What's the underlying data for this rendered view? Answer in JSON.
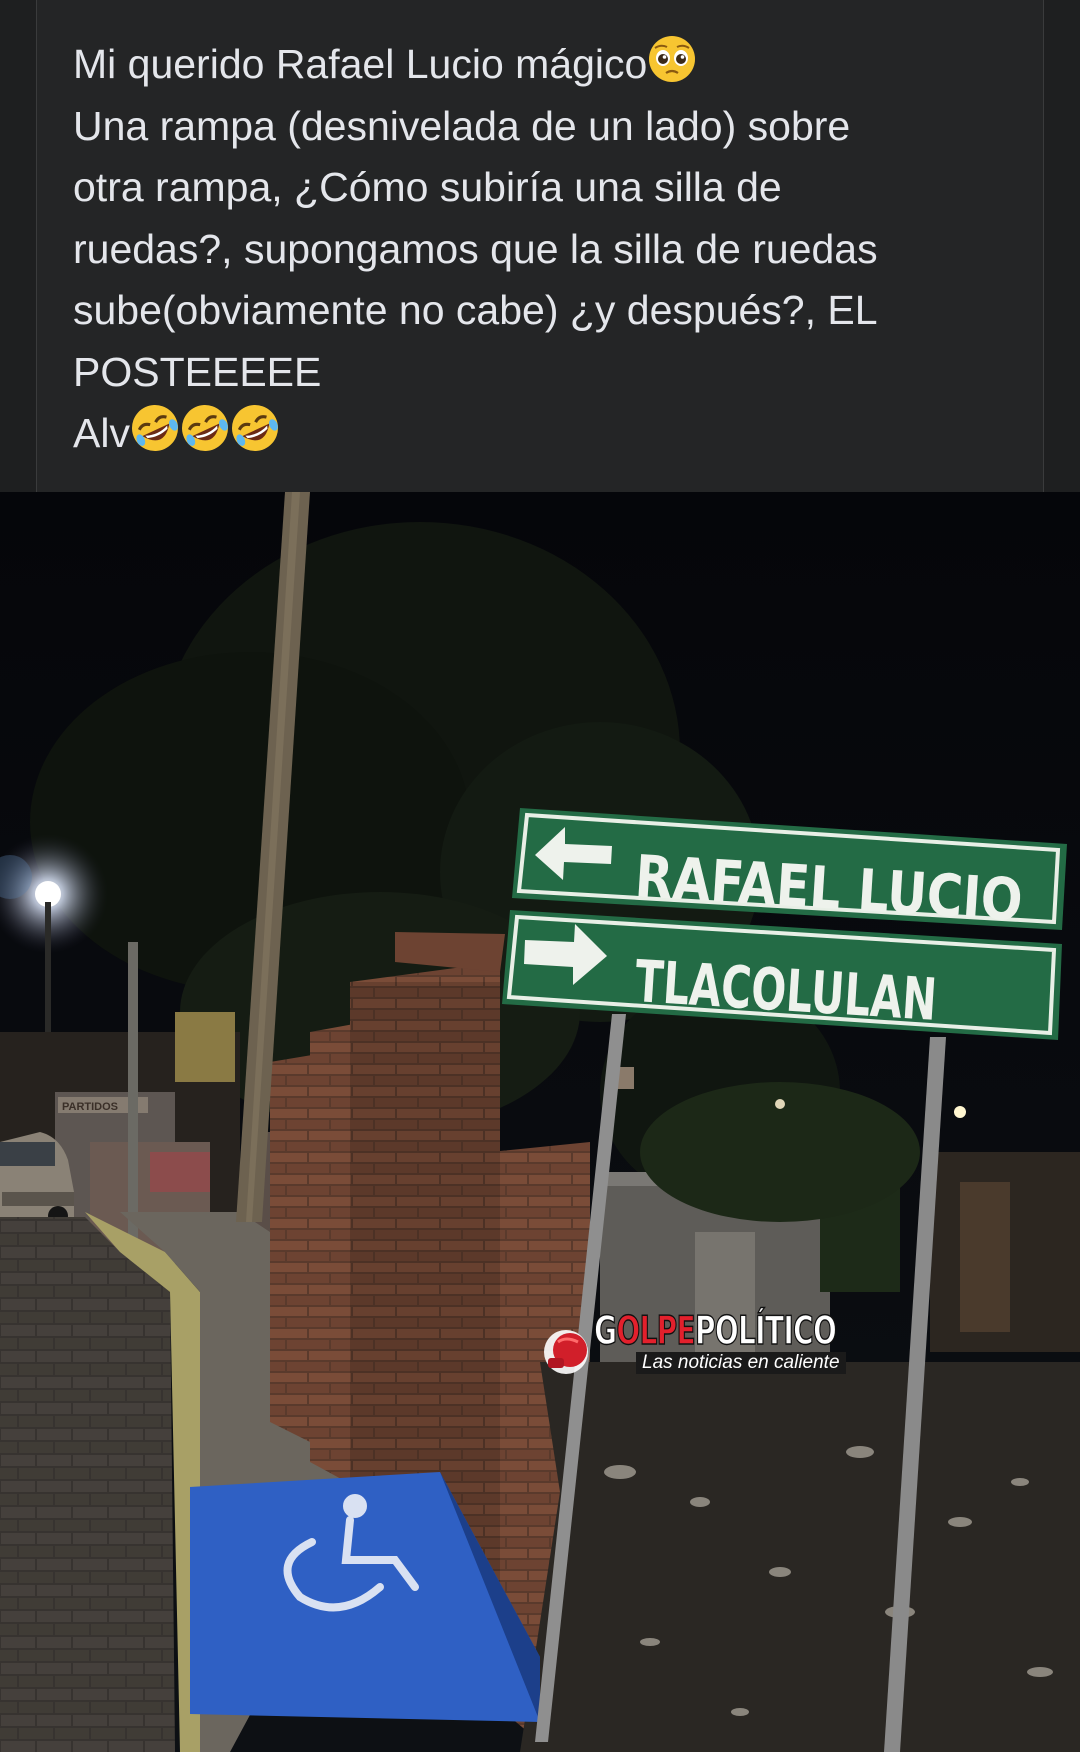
{
  "caption": {
    "lines": [
      {
        "text": "Mi querido Rafael Lucio mágico",
        "emoji": "pleading-face-emoji"
      },
      {
        "text": "Una rampa (desnivelada de un lado) sobre"
      },
      {
        "text": "otra rampa, ¿Cómo subiría una silla de"
      },
      {
        "text": "ruedas?, supongamos que la silla de ruedas"
      },
      {
        "text": "sube(obviamente no cabe) ¿y después?, EL"
      },
      {
        "text": "POSTEEEEE"
      },
      {
        "text": "Alv",
        "emoji": "rolling-on-floor-laughing-emoji x3"
      }
    ]
  },
  "photo": {
    "signs": {
      "top": {
        "text": "RAFAEL LUCIO",
        "arrow": "left-arrow-icon"
      },
      "bottom": {
        "text": "TLACOLULAN",
        "arrow": "right-arrow-icon"
      },
      "color": "#236b45"
    },
    "ramp_symbol": "wheelchair-icon",
    "ramp_color": "#2f60c4",
    "storefront_text": "PARTIDOS"
  },
  "watermark": {
    "title_prefix": "G",
    "title_red": "OLPE",
    "title_white": "POLÍTICO",
    "tagline": "Las noticias en caliente"
  }
}
